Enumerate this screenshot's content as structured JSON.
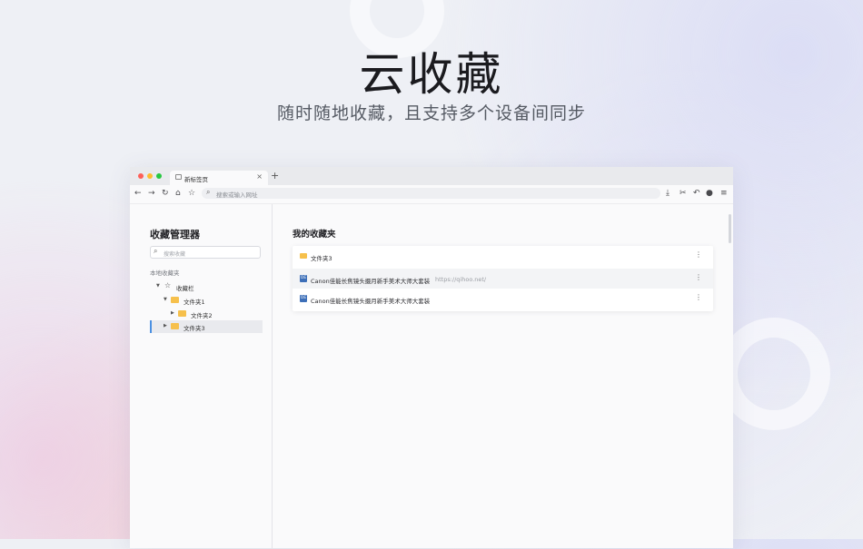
{
  "hero": {
    "title": "云收藏",
    "subtitle": "随时随地收藏，且支持多个设备间同步"
  },
  "browser": {
    "tab": {
      "title": "新标签页",
      "close": "×"
    },
    "new_tab": "+",
    "address_placeholder": "搜索或输入网址"
  },
  "sidebar": {
    "title": "收藏管理器",
    "search_placeholder": "搜索收藏",
    "section_label": "本地收藏夹",
    "tree": [
      {
        "label": "收藏栏",
        "expanded": true
      },
      {
        "label": "文件夹1",
        "expanded": true
      },
      {
        "label": "文件夹2",
        "expanded": false
      },
      {
        "label": "文件夹3",
        "expanded": false,
        "selected": true
      }
    ]
  },
  "main": {
    "title": "我的收藏夹",
    "items": [
      {
        "type": "folder",
        "name": "文件夹3"
      },
      {
        "type": "bookmark",
        "name": "Canon佳能长焦镜头摄月新手美术大师大套装",
        "url": "https://qihoo.net/"
      },
      {
        "type": "bookmark",
        "name": "Canon佳能长焦镜头摄月新手美术大师大套装"
      }
    ]
  },
  "colors": {
    "folder": "#f6c04c",
    "selected_accent": "#4a90e2",
    "traffic_red": "#fe5f57",
    "traffic_yellow": "#febc2e",
    "traffic_green": "#28c840"
  }
}
